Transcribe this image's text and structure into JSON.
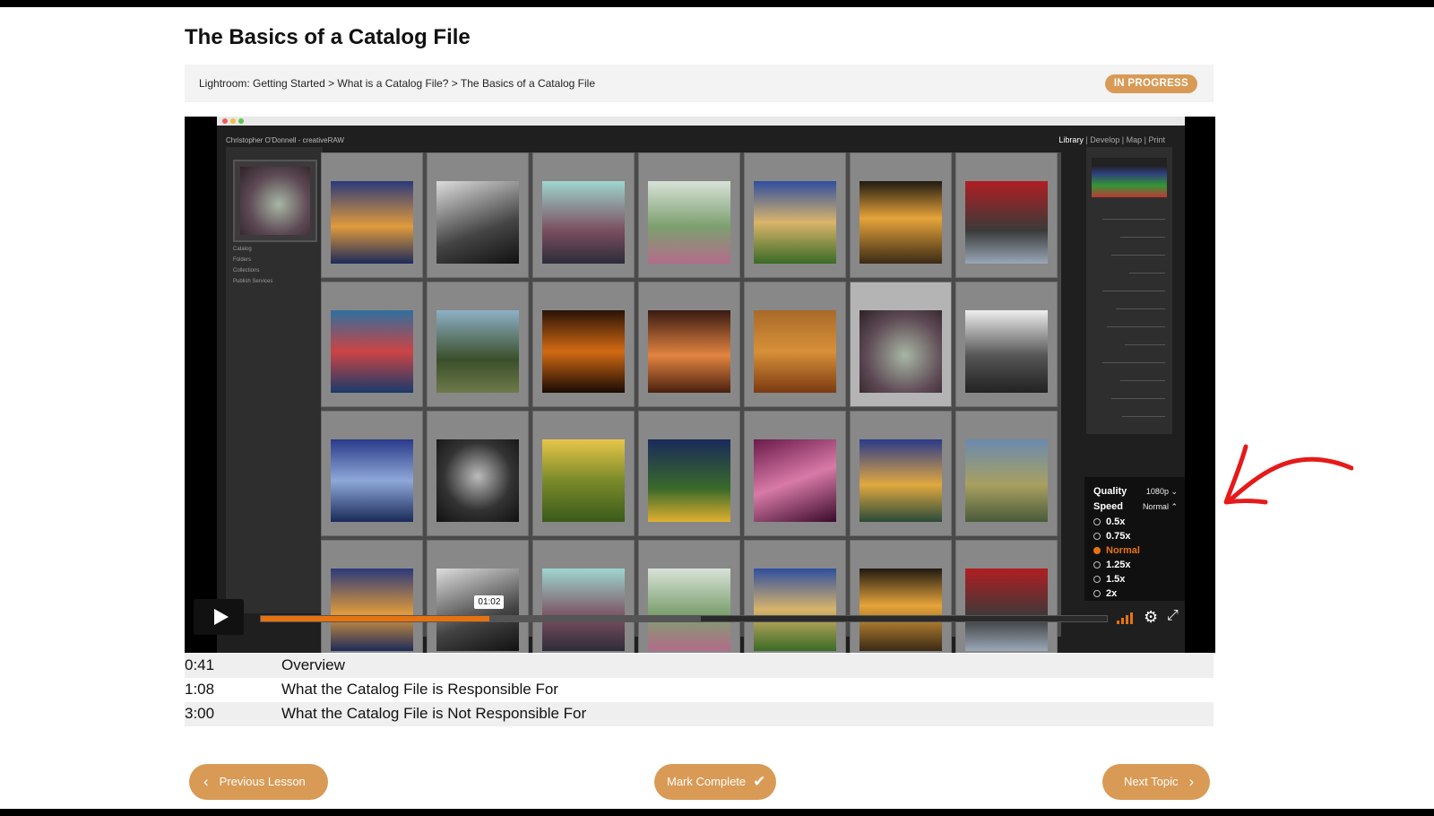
{
  "page": {
    "title": "The Basics of a Catalog File",
    "breadcrumb": "Lightroom: Getting Started > What is a Catalog File? > The Basics of a Catalog File",
    "status": "IN PROGRESS"
  },
  "player": {
    "lightroom": {
      "identity_plate": "Christopher O'Donnell - creativeRAW",
      "modules": [
        "Library",
        "Develop",
        "Map",
        "Print"
      ],
      "active_module": "Library",
      "left_panels": [
        "Catalog",
        "Folders",
        "Collections",
        "Publish Services"
      ]
    },
    "current_time": "01:02",
    "progress_fraction": 0.27,
    "buffered_fraction": 0.52,
    "settings": {
      "quality_label": "Quality",
      "quality_value": "1080p",
      "speed_label": "Speed",
      "speed_value": "Normal",
      "speed_options": [
        "0.5x",
        "0.75x",
        "Normal",
        "1.25x",
        "1.5x",
        "2x"
      ],
      "selected_speed": "Normal"
    },
    "accent_color": "#e8730e"
  },
  "chapters": [
    {
      "time": "0:41",
      "title": "Overview"
    },
    {
      "time": "1:08",
      "title": "What the Catalog File is Responsible For"
    },
    {
      "time": "3:00",
      "title": "What the Catalog File is Not Responsible For"
    }
  ],
  "navigation": {
    "previous": "Previous Lesson",
    "complete": "Mark Complete",
    "next": "Next Topic"
  },
  "colors": {
    "brand": "#d99a56",
    "progress": "#e8730e"
  }
}
